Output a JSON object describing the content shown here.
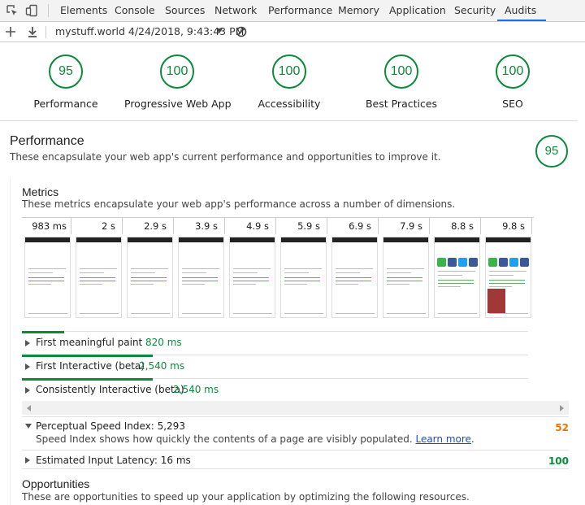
{
  "devtools": {
    "tabs": [
      {
        "label": "Elements"
      },
      {
        "label": "Console"
      },
      {
        "label": "Sources"
      },
      {
        "label": "Network"
      },
      {
        "label": "Performance"
      },
      {
        "label": "Memory"
      },
      {
        "label": "Application"
      },
      {
        "label": "Security"
      },
      {
        "label": "Audits"
      }
    ],
    "active_tab": "Audits",
    "accent_color": "#1a73e8"
  },
  "toolbar": {
    "report_label": "mystuff.world 4/24/2018, 9:43:43 PM",
    "icons": [
      "plus-icon",
      "download-icon",
      "chevron-down-icon",
      "clear-icon"
    ]
  },
  "scores": [
    {
      "value": "95",
      "label": "Performance"
    },
    {
      "value": "100",
      "label": "Progressive Web App"
    },
    {
      "value": "100",
      "label": "Accessibility"
    },
    {
      "value": "100",
      "label": "Best Practices"
    },
    {
      "value": "100",
      "label": "SEO"
    }
  ],
  "score_color": "#0b8a3a",
  "performance": {
    "title": "Performance",
    "description": "These encapsulate your web app's current performance and opportunities to improve it.",
    "score": "95",
    "metrics": {
      "title": "Metrics",
      "description": "These metrics encapsulate your web app's performance across a number of dimensions.",
      "filmstrip": [
        "983 ms",
        "2 s",
        "2.9 s",
        "3.9 s",
        "4.9 s",
        "5.9 s",
        "6.9 s",
        "7.9 s",
        "8.8 s",
        "9.8 s"
      ],
      "rows": [
        {
          "label": "First meaningful paint",
          "value": "820 ms",
          "bar_fraction": 0.082
        },
        {
          "label": "First Interactive (beta)",
          "value": "2,540 ms",
          "bar_fraction": 0.254
        },
        {
          "label": "Consistently Interactive (beta)",
          "value": "2,540 ms",
          "bar_fraction": 0.254
        }
      ],
      "psi": {
        "label": "Perceptual Speed Index: 5,293",
        "description": "Speed Index shows how quickly the contents of a page are visibly populated.",
        "link": "Learn more",
        "link_suffix": ".",
        "score": "52",
        "score_color": "#e67700"
      },
      "eil": {
        "label": "Estimated Input Latency: 16 ms",
        "score": "100"
      }
    },
    "opportunities": {
      "title": "Opportunities",
      "description": "These are opportunities to speed up your application by optimizing the following resources."
    }
  }
}
